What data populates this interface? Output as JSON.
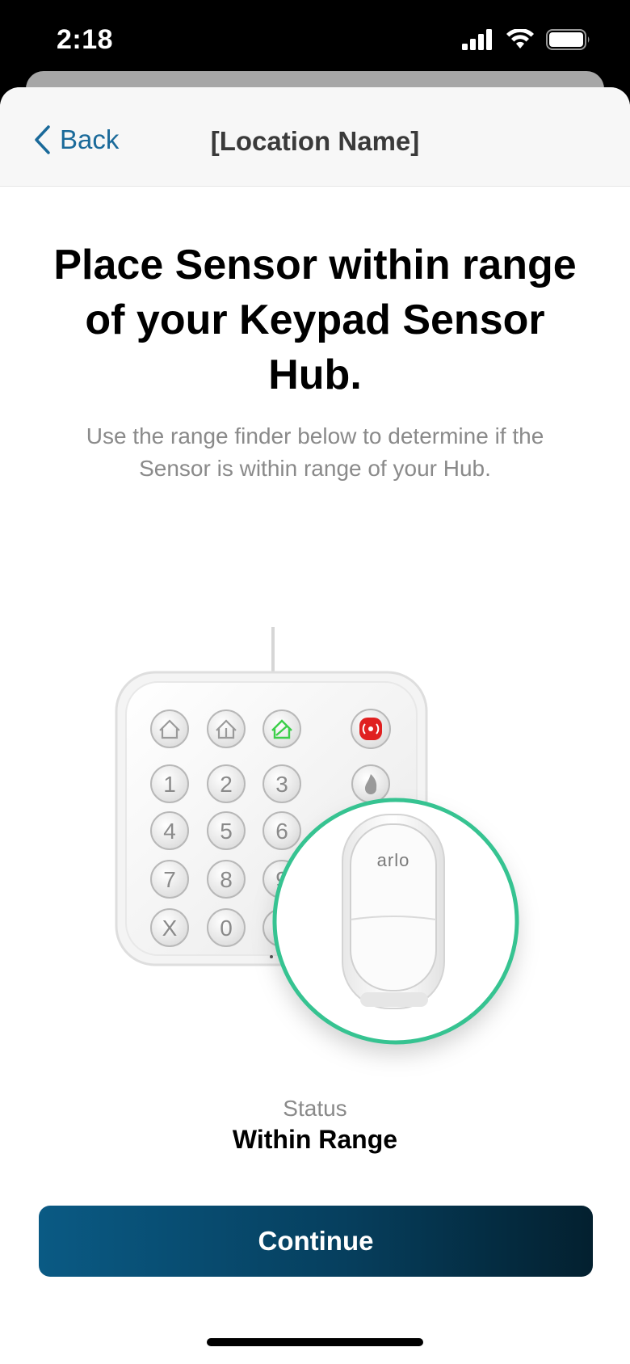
{
  "status_bar": {
    "time": "2:18"
  },
  "nav": {
    "back_label": "Back",
    "title": "[Location Name]"
  },
  "main": {
    "headline": "Place Sensor within range of your Keypad Sensor Hub.",
    "description": "Use the range finder below to determine if the Sensor is within range of your Hub."
  },
  "illustration": {
    "keypad_keys": [
      "1",
      "2",
      "3",
      "4",
      "5",
      "6",
      "7",
      "8",
      "9",
      "X",
      "0"
    ],
    "sensor_brand": "arlo",
    "ring_color": "#36c391",
    "alarm_color": "#e02020"
  },
  "status": {
    "label": "Status",
    "value": "Within Range"
  },
  "actions": {
    "continue_label": "Continue"
  },
  "colors": {
    "accent": "#1a6a9a",
    "button_start": "#0a5a84",
    "button_end": "#03202f"
  }
}
